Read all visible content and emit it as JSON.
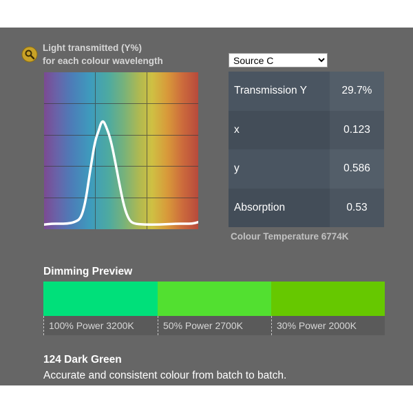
{
  "graph": {
    "title_line1": "Light transmitted (Y%)",
    "title_line2": "for each colour wavelength",
    "curve": [
      [
        0,
        3
      ],
      [
        0.05,
        3.5
      ],
      [
        0.1,
        3.5
      ],
      [
        0.15,
        3.5
      ],
      [
        0.2,
        4.5
      ],
      [
        0.24,
        7
      ],
      [
        0.27,
        18
      ],
      [
        0.3,
        38
      ],
      [
        0.33,
        56
      ],
      [
        0.355,
        63
      ],
      [
        0.37,
        68
      ],
      [
        0.385,
        69
      ],
      [
        0.4,
        66
      ],
      [
        0.43,
        58
      ],
      [
        0.46,
        44
      ],
      [
        0.49,
        28
      ],
      [
        0.52,
        14
      ],
      [
        0.55,
        6
      ],
      [
        0.58,
        3.5
      ],
      [
        0.65,
        3
      ],
      [
        0.75,
        3
      ],
      [
        0.85,
        3.5
      ],
      [
        0.92,
        3.5
      ],
      [
        0.96,
        3.5
      ],
      [
        1.0,
        4.5
      ]
    ]
  },
  "source": {
    "selected": "Source C",
    "options": [
      "Source C"
    ]
  },
  "metrics": [
    {
      "label": "Transmission Y",
      "value": "29.7%"
    },
    {
      "label": "x",
      "value": "0.123"
    },
    {
      "label": "y",
      "value": "0.586"
    },
    {
      "label": "Absorption",
      "value": "0.53"
    }
  ],
  "colour_temperature": "Colour Temperature 6774K",
  "dimming": {
    "title": "Dimming Preview",
    "swatches": [
      {
        "color": "#00e07a",
        "label": "100% Power 3200K"
      },
      {
        "color": "#52e030",
        "label": "50% Power 2700K"
      },
      {
        "color": "#66c800",
        "label": "30% Power 2000K"
      }
    ]
  },
  "product": {
    "name": "124 Dark Green",
    "description": "Accurate and consistent colour from batch to batch."
  },
  "colors": {
    "panel_bg": "#666666",
    "table_label_bg": "#4a5561",
    "table_value_bg": "#535e69"
  }
}
